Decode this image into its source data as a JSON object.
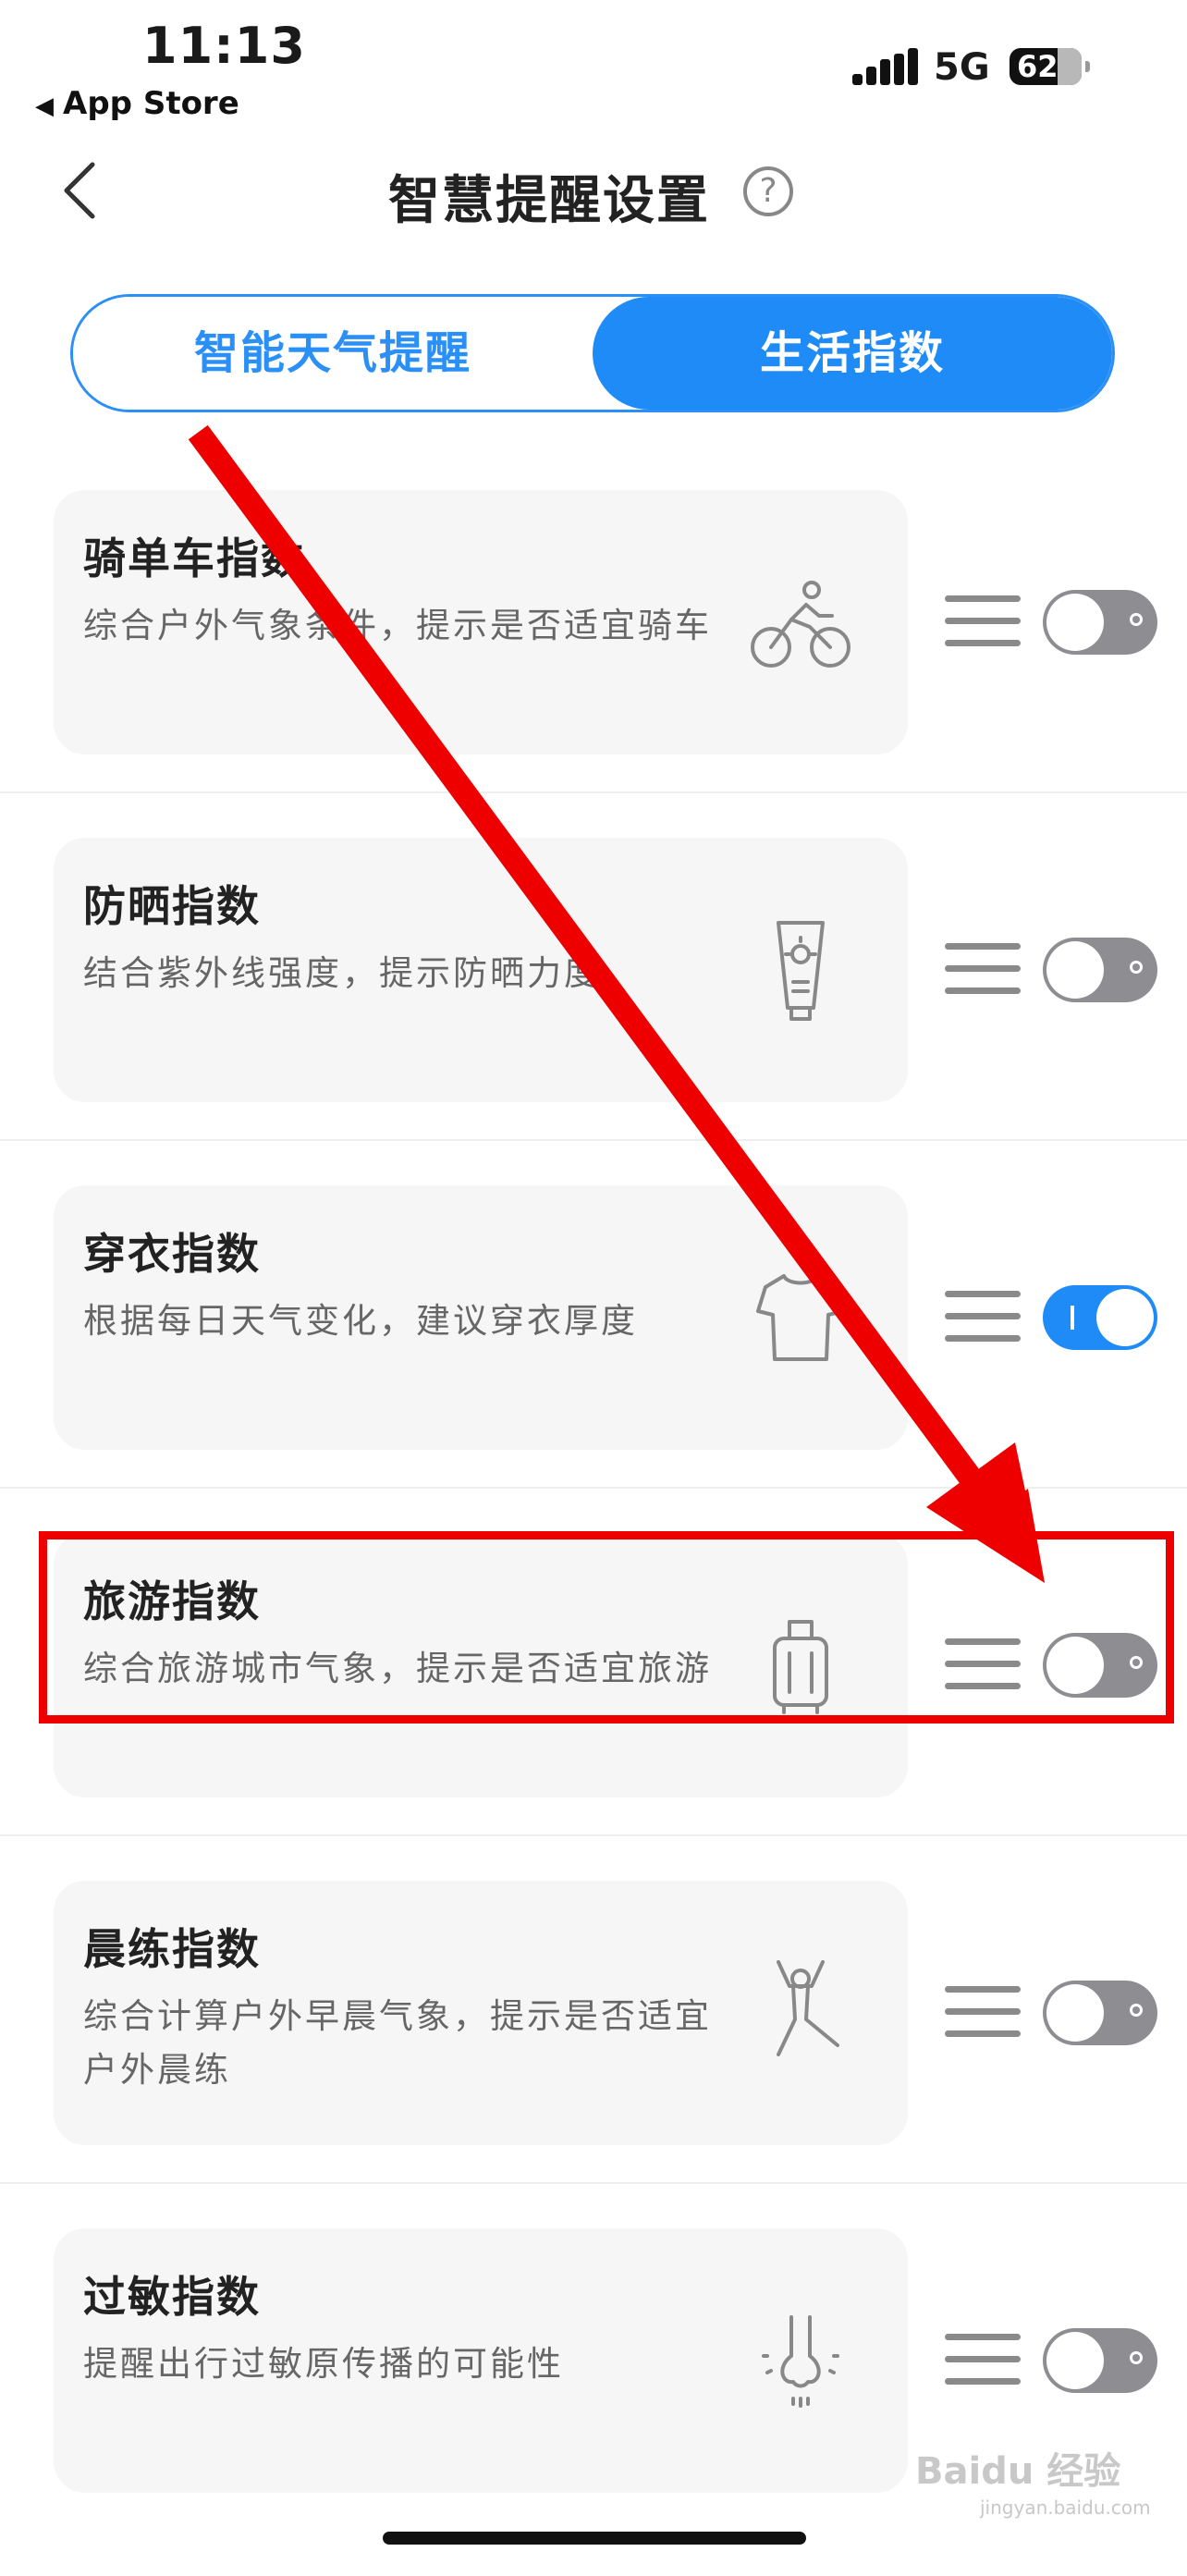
{
  "status_bar": {
    "time": "11:13",
    "back_app": "App Store",
    "network": "5G",
    "battery": "62"
  },
  "header": {
    "title": "智慧提醒设置",
    "help": "?"
  },
  "tabs": [
    {
      "label": "智能天气提醒",
      "active": false
    },
    {
      "label": "生活指数",
      "active": true
    }
  ],
  "items": [
    {
      "title": "骑单车指数",
      "desc": "综合户外气象条件，提示是否适宜骑车",
      "icon": "bicycle-icon",
      "enabled": false
    },
    {
      "title": "防晒指数",
      "desc": "结合紫外线强度，提示防晒力度",
      "icon": "sunscreen-icon",
      "enabled": false
    },
    {
      "title": "穿衣指数",
      "desc": "根据每日天气变化，建议穿衣厚度",
      "icon": "tshirt-icon",
      "enabled": true
    },
    {
      "title": "旅游指数",
      "desc": "综合旅游城市气象，提示是否适宜旅游",
      "icon": "luggage-icon",
      "enabled": false
    },
    {
      "title": "晨练指数",
      "desc": "综合计算户外早晨气象，提示是否适宜户外晨练",
      "icon": "exercise-icon",
      "enabled": false
    },
    {
      "title": "过敏指数",
      "desc": "提醒出行过敏原传播的可能性",
      "icon": "allergy-icon",
      "enabled": false
    }
  ],
  "watermark": {
    "brand": "Baidu 经验",
    "url": "jingyan.baidu.com"
  },
  "colors": {
    "accent": "#1f8bf7",
    "toggle_off": "#8d8d92",
    "annotation": "#ee0000",
    "card_bg": "#f6f6f6"
  }
}
